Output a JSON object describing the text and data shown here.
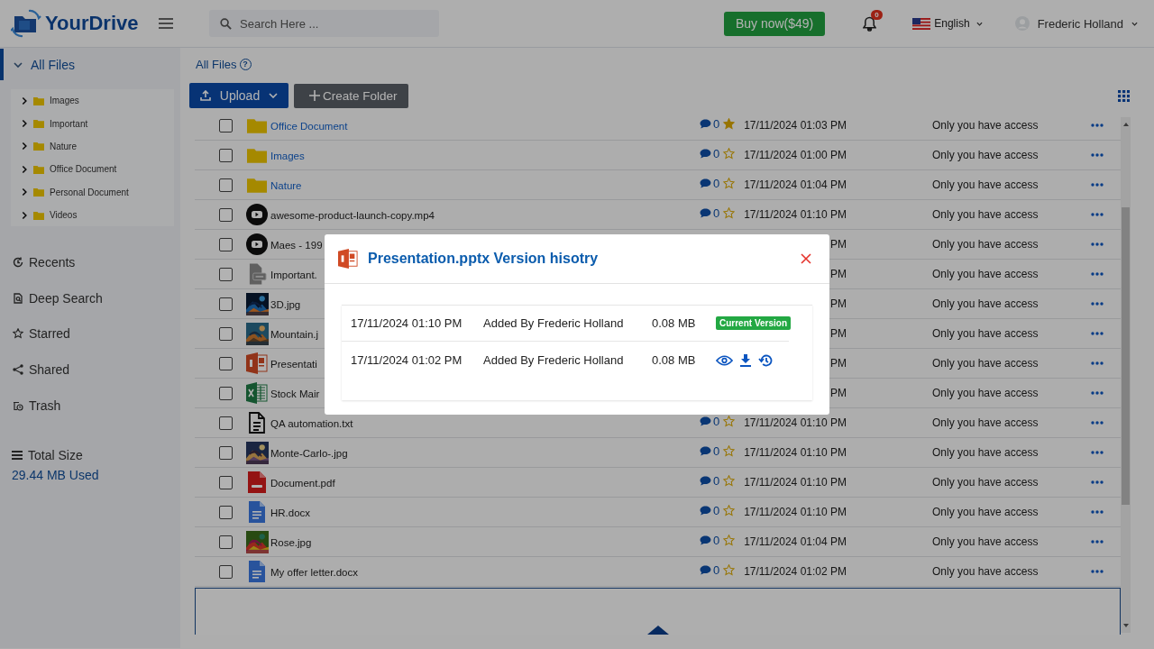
{
  "header": {
    "logo": "YourDrive",
    "search": {
      "placeholder": "Search Here ..."
    },
    "buy_button": "Buy now($49)",
    "notifications": {
      "count": "0"
    },
    "language": "English",
    "user": "Frederic Holland"
  },
  "sidebar": {
    "root": {
      "label": "All Files",
      "selected": true,
      "expanded": true,
      "children": [
        {
          "label": "Images",
          "expanded": false
        },
        {
          "label": "Important",
          "expanded": false
        },
        {
          "label": "Nature",
          "expanded": false
        },
        {
          "label": "Office Document",
          "expanded": false
        },
        {
          "label": "Personal Document",
          "expanded": false
        },
        {
          "label": "Videos",
          "expanded": false
        }
      ]
    },
    "items": [
      {
        "label": "Recents",
        "kind": "recents"
      },
      {
        "label": "Deep Search",
        "kind": "search"
      },
      {
        "label": "Starred",
        "kind": "starred"
      },
      {
        "label": "Shared",
        "kind": "shared"
      },
      {
        "label": "Trash",
        "kind": "trash"
      }
    ],
    "storage": {
      "label": "Total Size",
      "used": "29.44 MB Used"
    }
  },
  "breadcrumb": {
    "label": "All Files",
    "help": "?"
  },
  "toolbar": {
    "upload": "Upload",
    "create_folder": "Create Folder"
  },
  "files": {
    "rows": [
      {
        "kind": "folder",
        "name": "Office Document",
        "comments": "0",
        "starred": true,
        "date": "17/11/2024 01:03 PM",
        "access": "Only you have access",
        "checked": false
      },
      {
        "kind": "folder",
        "name": "Images",
        "comments": "0",
        "starred": false,
        "date": "17/11/2024 01:00 PM",
        "access": "Only you have access",
        "checked": false
      },
      {
        "kind": "folder",
        "name": "Nature",
        "comments": "0",
        "starred": false,
        "date": "17/11/2024 01:04 PM",
        "access": "Only you have access",
        "checked": false
      },
      {
        "kind": "video",
        "name": "awesome-product-launch-copy.mp4",
        "comments": "0",
        "starred": false,
        "date": "17/11/2024 01:10 PM",
        "access": "Only you have access",
        "checked": false
      },
      {
        "kind": "video",
        "name": "Maes - 199",
        "date": "PM",
        "access": "Only you have access",
        "checked": false
      },
      {
        "kind": "zip",
        "name": "Important.",
        "date": "PM",
        "access": "Only you have access",
        "checked": false
      },
      {
        "name": "3D.jpg",
        "date": "PM",
        "access": "Only you have access",
        "checked": false
      },
      {
        "name": "Mountain.j",
        "date": "PM",
        "access": "Only you have access",
        "checked": false
      },
      {
        "kind": "pptx",
        "name": "Presentati",
        "date": "PM",
        "access": "Only you have access",
        "checked": false
      },
      {
        "kind": "xlsx",
        "name": "Stock Mair",
        "date": "PM",
        "access": "Only you have access",
        "checked": false
      },
      {
        "kind": "txt",
        "name": "QA automation.txt",
        "comments": "0",
        "starred": false,
        "date": "17/11/2024 01:10 PM",
        "access": "Only you have access",
        "checked": false
      },
      {
        "name": "Monte-Carlo-.jpg",
        "comments": "0",
        "starred": false,
        "date": "17/11/2024 01:10 PM",
        "access": "Only you have access",
        "checked": false
      },
      {
        "kind": "pdf",
        "name": "Document.pdf",
        "comments": "0",
        "starred": false,
        "date": "17/11/2024 01:10 PM",
        "access": "Only you have access",
        "checked": false
      },
      {
        "kind": "docx",
        "name": "HR.docx",
        "comments": "0",
        "starred": false,
        "date": "17/11/2024 01:10 PM",
        "access": "Only you have access",
        "checked": false
      },
      {
        "name": "Rose.jpg",
        "comments": "0",
        "starred": false,
        "date": "17/11/2024 01:04 PM",
        "access": "Only you have access",
        "checked": false
      },
      {
        "kind": "docx",
        "name": "My offer letter.docx",
        "comments": "0",
        "starred": false,
        "date": "17/11/2024 01:02 PM",
        "access": "Only you have access",
        "checked": false
      }
    ]
  },
  "modal": {
    "title": "Presentation.pptx Version hisotry",
    "versions": [
      {
        "date": "17/11/2024 01:10 PM",
        "added_by": "Added By Frederic Holland",
        "size": "0.08 MB",
        "current": true,
        "badge": "Current Version"
      },
      {
        "date": "17/11/2024 01:02 PM",
        "added_by": "Added By Frederic Holland",
        "size": "0.08 MB",
        "current": false
      }
    ]
  }
}
